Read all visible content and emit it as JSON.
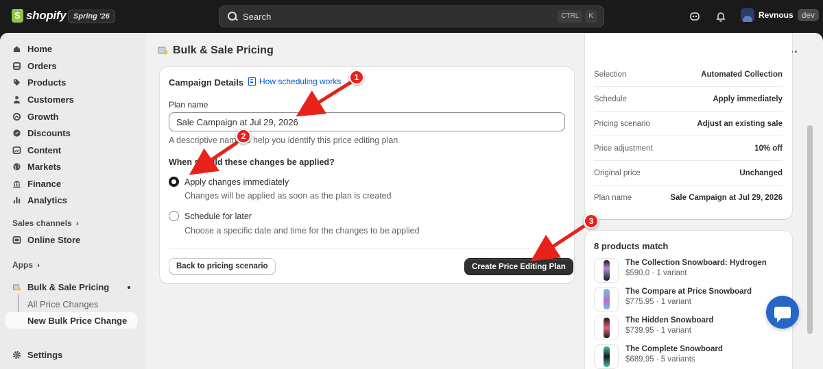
{
  "topbar": {
    "brand": "shopify",
    "version": "Spring '26",
    "search_placeholder": "Search",
    "shortcut_ctrl": "CTRL",
    "shortcut_key": "K",
    "user_name": "Revnous",
    "user_badge": "dev"
  },
  "sidebar": {
    "items": [
      {
        "label": "Home",
        "icon": "home-icon"
      },
      {
        "label": "Orders",
        "icon": "orders-icon"
      },
      {
        "label": "Products",
        "icon": "tag-icon"
      },
      {
        "label": "Customers",
        "icon": "person-icon"
      },
      {
        "label": "Growth",
        "icon": "growth-icon"
      },
      {
        "label": "Discounts",
        "icon": "discount-icon"
      },
      {
        "label": "Content",
        "icon": "content-icon"
      },
      {
        "label": "Markets",
        "icon": "globe-icon"
      },
      {
        "label": "Finance",
        "icon": "bank-icon"
      },
      {
        "label": "Analytics",
        "icon": "chart-icon"
      }
    ],
    "sales_channels_label": "Sales channels",
    "online_store": "Online Store",
    "apps_label": "Apps",
    "app_name": "Bulk & Sale Pricing",
    "sub_all": "All Price Changes",
    "sub_new": "New Bulk Price Change",
    "settings": "Settings"
  },
  "page": {
    "title": "Bulk & Sale Pricing"
  },
  "campaign": {
    "heading": "Campaign Details",
    "help_link": "How scheduling works",
    "plan_name_label": "Plan name",
    "plan_name_value": "Sale Campaign at Jul 29, 2026",
    "plan_name_help": "A descriptive name to help you identify this price editing plan",
    "question": "When should these changes be applied?",
    "option_now": "Apply changes immediately",
    "option_now_desc": "Changes will be applied as soon as the plan is created",
    "option_later": "Schedule for later",
    "option_later_desc": "Choose a specific date and time for the changes to be applied",
    "selected_option": "now",
    "back_button": "Back to pricing scenario",
    "create_button": "Create Price Editing Plan"
  },
  "summary": {
    "rows": [
      {
        "key": "Selection",
        "value": "Automated Collection"
      },
      {
        "key": "Schedule",
        "value": "Apply immediately"
      },
      {
        "key": "Pricing scenario",
        "value": "Adjust an existing sale"
      },
      {
        "key": "Price adjustment",
        "value": "10% off"
      },
      {
        "key": "Original price",
        "value": "Unchanged"
      },
      {
        "key": "Plan name",
        "value": "Sale Campaign at Jul 29, 2026"
      }
    ]
  },
  "products": {
    "heading": "8 products match",
    "items": [
      {
        "name": "The Collection Snowboard: Hydrogen",
        "meta": "$590.0 · 1 variant",
        "color": "#b58ad6"
      },
      {
        "name": "The Compare at Price Snowboard",
        "meta": "$775.95 · 1 variant",
        "color": "#5ec8e0"
      },
      {
        "name": "The Hidden Snowboard",
        "meta": "$739.95 · 1 variant",
        "color": "#e8607a"
      },
      {
        "name": "The Complete Snowboard",
        "meta": "$689.95 · 5 variants",
        "color": "#40c0b0"
      }
    ]
  },
  "annotations": [
    "1",
    "2",
    "3"
  ],
  "colors": {
    "accent": "#005bd3",
    "primary_button": "#303030",
    "annotation": "#e8221b"
  }
}
